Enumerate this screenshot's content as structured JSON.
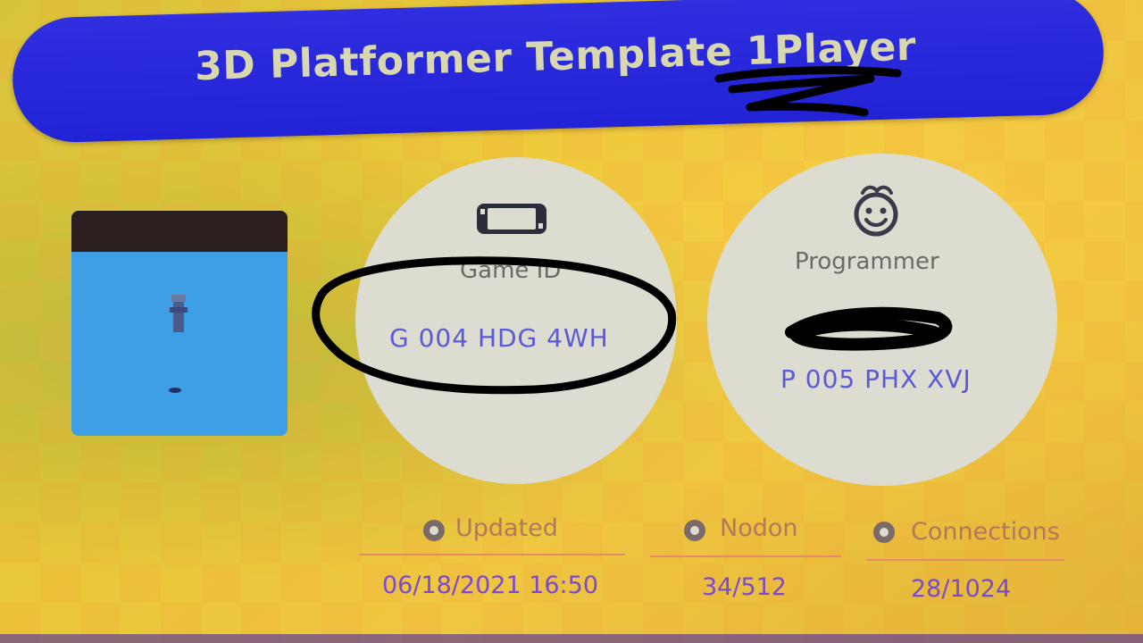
{
  "header": {
    "title": "3D Platformer Template 1Player"
  },
  "game": {
    "id_label": "Game ID",
    "id_value": "G 004 HDG 4WH"
  },
  "programmer": {
    "label": "Programmer",
    "id_value": "P 005 PHX XVJ"
  },
  "stats": {
    "updated": {
      "label": "Updated",
      "value": "06/18/2021 16:50"
    },
    "nodon": {
      "label": "Nodon",
      "value": "34/512"
    },
    "connections": {
      "label": "Connections",
      "value": "28/1024"
    }
  },
  "icons": {
    "game_id": "handheld-console-icon",
    "programmer": "smiling-face-icon",
    "updated": "clock-icon",
    "nodon": "nodon-icon",
    "connections": "link-icon"
  },
  "colors": {
    "banner": "#2a2ad9",
    "background": "#e8c43c",
    "id_text": "#5a5ad8",
    "stat_value": "#7a4ad0",
    "divider": "#e88a6a"
  }
}
